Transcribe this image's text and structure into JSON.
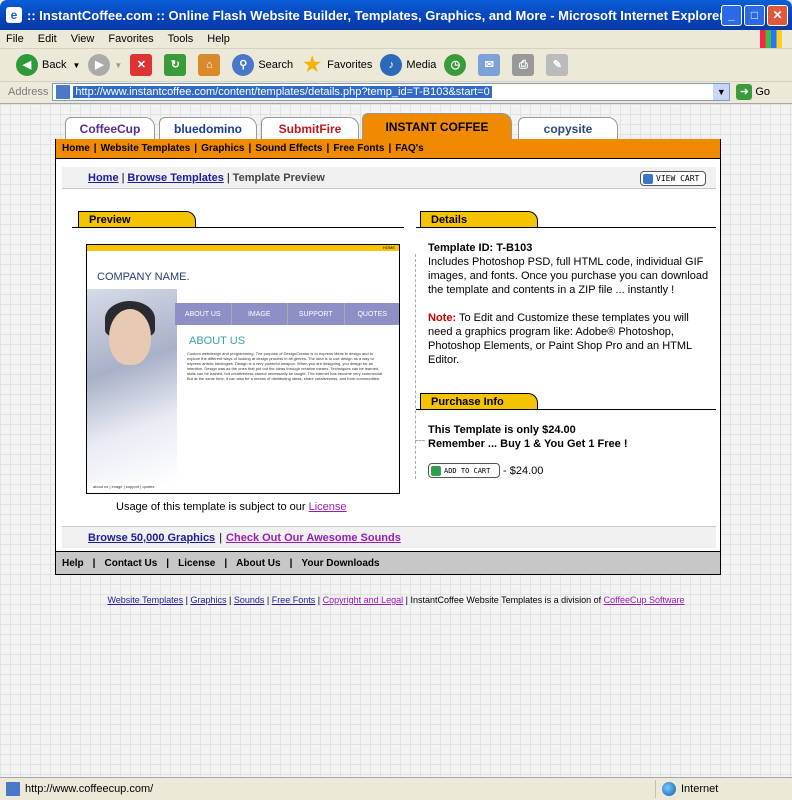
{
  "window": {
    "title": ":: InstantCoffee.com :: Online Flash Website Builder, Templates, Graphics, and More - Microsoft Internet Explorer",
    "minimize": "_",
    "maximize": "□",
    "close": "✕"
  },
  "menu": [
    "File",
    "Edit",
    "View",
    "Favorites",
    "Tools",
    "Help"
  ],
  "toolbar": {
    "back": "Back",
    "search": "Search",
    "favorites": "Favorites",
    "media": "Media"
  },
  "address": {
    "label": "Address",
    "url": "http://www.instantcoffee.com/content/templates/details.php?temp_id=T-B103&start=0",
    "go": "Go"
  },
  "tabs": [
    "CoffeeCup",
    "bluedomino",
    "SubmitFire",
    "INSTANT COFFEE",
    "copysite"
  ],
  "nav": [
    "Home",
    "Website Templates",
    "Graphics",
    "Sound Effects",
    "Free Fonts",
    "FAQ's"
  ],
  "breadcrumb": {
    "home": "Home",
    "browse": "Browse Templates",
    "current": "Template Preview",
    "view_cart": "VIEW CART"
  },
  "preview": {
    "heading": "Preview",
    "company": "COMPANY NAME.",
    "home_tab": "HOME",
    "nav": [
      "ABOUT US",
      "IMAGE",
      "SUPPORT",
      "QUOTES"
    ],
    "about": "ABOUT US",
    "text": "Custom webdesign and programming. The purpose of DesignCreator is to express ideas in design and to explore the different ways of looking at design process in all genres. The idea is to use design as a way to express artistic ideologies. Design is a very powerful weapon. When you are designing, you design for an intention. Design was as the ones that put out the ideas through creative means. Techniques can be learned, skills can be trained, but creativeness cannot necessarily be taught. The internet has become very commercial. But at the same time, it can also be a means of distributing ideas, share creativeness, and form communities.",
    "footer": "about us | image | support | quotes",
    "usage": "Usage of this template is subject to our",
    "license": "License"
  },
  "details": {
    "heading": "Details",
    "template_id": "Template ID: T-B103",
    "description": "Includes Photoshop PSD, full HTML code, individual GIF images, and fonts. Once you purchase you can download the template and contents in a ZIP file ... instantly !",
    "note_label": "Note:",
    "note": "To Edit and Customize these templates you will need a graphics program like: Adobe® Photoshop, Photoshop Elements, or Paint Shop Pro and an HTML Editor."
  },
  "purchase": {
    "heading": "Purchase Info",
    "price_line": "This Template is only $24.00",
    "promo": "Remember ... Buy 1 & You Get 1 Free !",
    "add_to_cart": "ADD TO CART",
    "price": "- $24.00"
  },
  "bottom": {
    "graphics": "Browse 50,000 Graphics",
    "sounds": "Check Out Our Awesome Sounds"
  },
  "footnav": [
    "Help",
    "Contact Us",
    "License",
    "About Us",
    "Your Downloads"
  ],
  "footer_links": {
    "website_templates": "Website Templates",
    "graphics": "Graphics",
    "sounds": "Sounds",
    "free_fonts": "Free Fonts",
    "copyright": "Copyright and Legal",
    "division_text": "InstantCoffee Website Templates is a division of",
    "cc": "CoffeeCup Software"
  },
  "status": {
    "url": "http://www.coffeecup.com/",
    "zone": "Internet"
  }
}
